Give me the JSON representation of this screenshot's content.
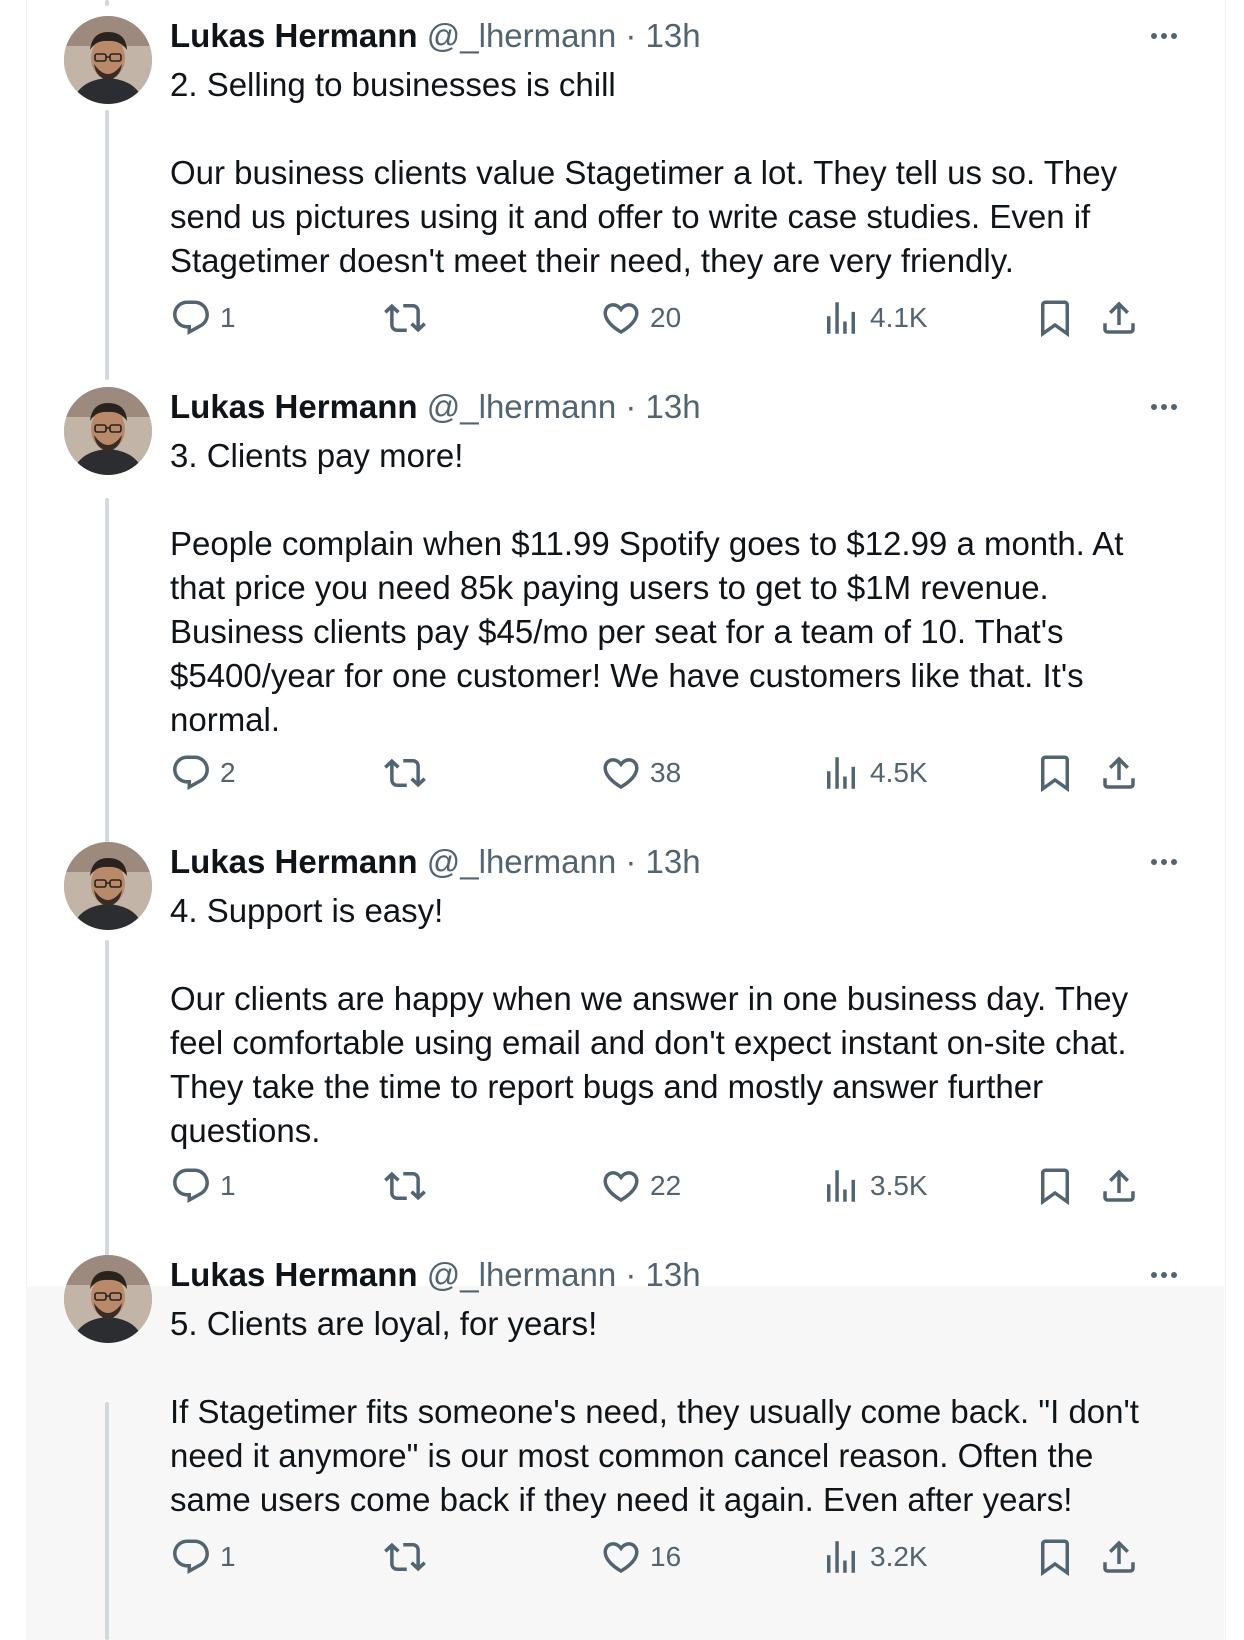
{
  "colors": {
    "text": "#0f1419",
    "secondary": "#536471",
    "thread_line": "#cfd9de"
  },
  "tweets": [
    {
      "author": "Lukas Hermann",
      "handle_time": "@_lhermann · 13h",
      "text": "2. Selling to businesses is chill\n\nOur business clients value Stagetimer a lot. They tell us so. They send us pictures using it and offer to write case studies. Even if Stagetimer doesn't meet their need, they are very friendly.",
      "replies": "1",
      "reposts": "",
      "likes": "20",
      "views": "4.1K"
    },
    {
      "author": "Lukas Hermann",
      "handle_time": "@_lhermann · 13h",
      "text": "3. Clients pay more!\n\nPeople complain when $11.99 Spotify goes to $12.99 a month. At that price you need 85k paying users to get to $1M revenue. Business clients pay $45/mo per seat for a team of 10. That's $5400/year for one customer! We have customers like that. It's normal.",
      "replies": "2",
      "reposts": "",
      "likes": "38",
      "views": "4.5K"
    },
    {
      "author": "Lukas Hermann",
      "handle_time": "@_lhermann · 13h",
      "text": "4. Support is easy!\n\nOur clients are happy when we answer in one business day. They feel comfortable using email and don't expect instant on-site chat. They take the time to report bugs and mostly answer further questions.",
      "replies": "1",
      "reposts": "",
      "likes": "22",
      "views": "3.5K"
    },
    {
      "author": "Lukas Hermann",
      "handle_time": "@_lhermann · 13h",
      "text": "5. Clients are loyal, for years!\n\nIf Stagetimer fits someone's need, they usually come back. \"I don't need it anymore\" is our most common cancel reason. Often the same users come back if they need it again. Even after years!",
      "replies": "1",
      "reposts": "",
      "likes": "16",
      "views": "3.2K"
    }
  ],
  "icons": {
    "reply": "reply-icon",
    "repost": "repost-icon",
    "like": "like-icon",
    "views": "views-icon",
    "bookmark": "bookmark-icon",
    "share": "share-icon",
    "more": "more-icon"
  }
}
